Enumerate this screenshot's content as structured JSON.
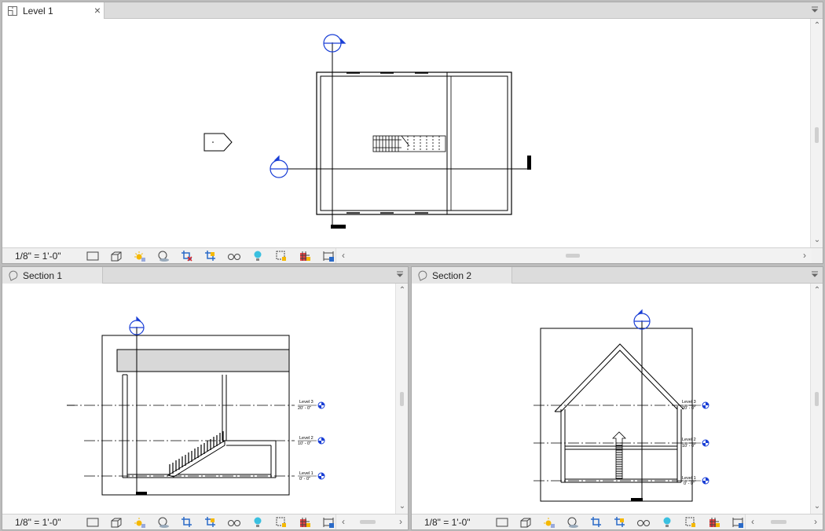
{
  "views": {
    "top": {
      "title": "Level 1",
      "scale": "1/8\" = 1'-0\""
    },
    "left": {
      "title": "Section 1",
      "scale": "1/8\" = 1'-0\""
    },
    "right": {
      "title": "Section 2",
      "scale": "1/8\" = 1'-0\""
    }
  },
  "levels": [
    {
      "name": "Level 3",
      "elevation": "20' - 0\""
    },
    {
      "name": "Level 2",
      "elevation": "10' - 0\""
    },
    {
      "name": "Level 1",
      "elevation": "0' - 0\""
    }
  ],
  "status_icons": [
    "model-display-icon",
    "3d-box-icon",
    "sun-path-icon",
    "shadows-icon",
    "crop-view-icon",
    "crop-region-icon",
    "temporary-hide-icon",
    "reveal-hidden-icon",
    "lightbulb-icon",
    "highlight-displacement-icon",
    "worksharing-icon",
    "analytical-model-icon"
  ],
  "colors": {
    "accent_blue": "#1a3fd6",
    "tab_active": "#ffffff",
    "tab_inactive": "#e6e6e6",
    "floor_fill": "#d8d8d8"
  },
  "icons": {
    "close": "×",
    "menu": "▾",
    "scroll_up": "⌃",
    "scroll_down": "⌄",
    "scroll_left": "‹",
    "scroll_right": "›"
  }
}
